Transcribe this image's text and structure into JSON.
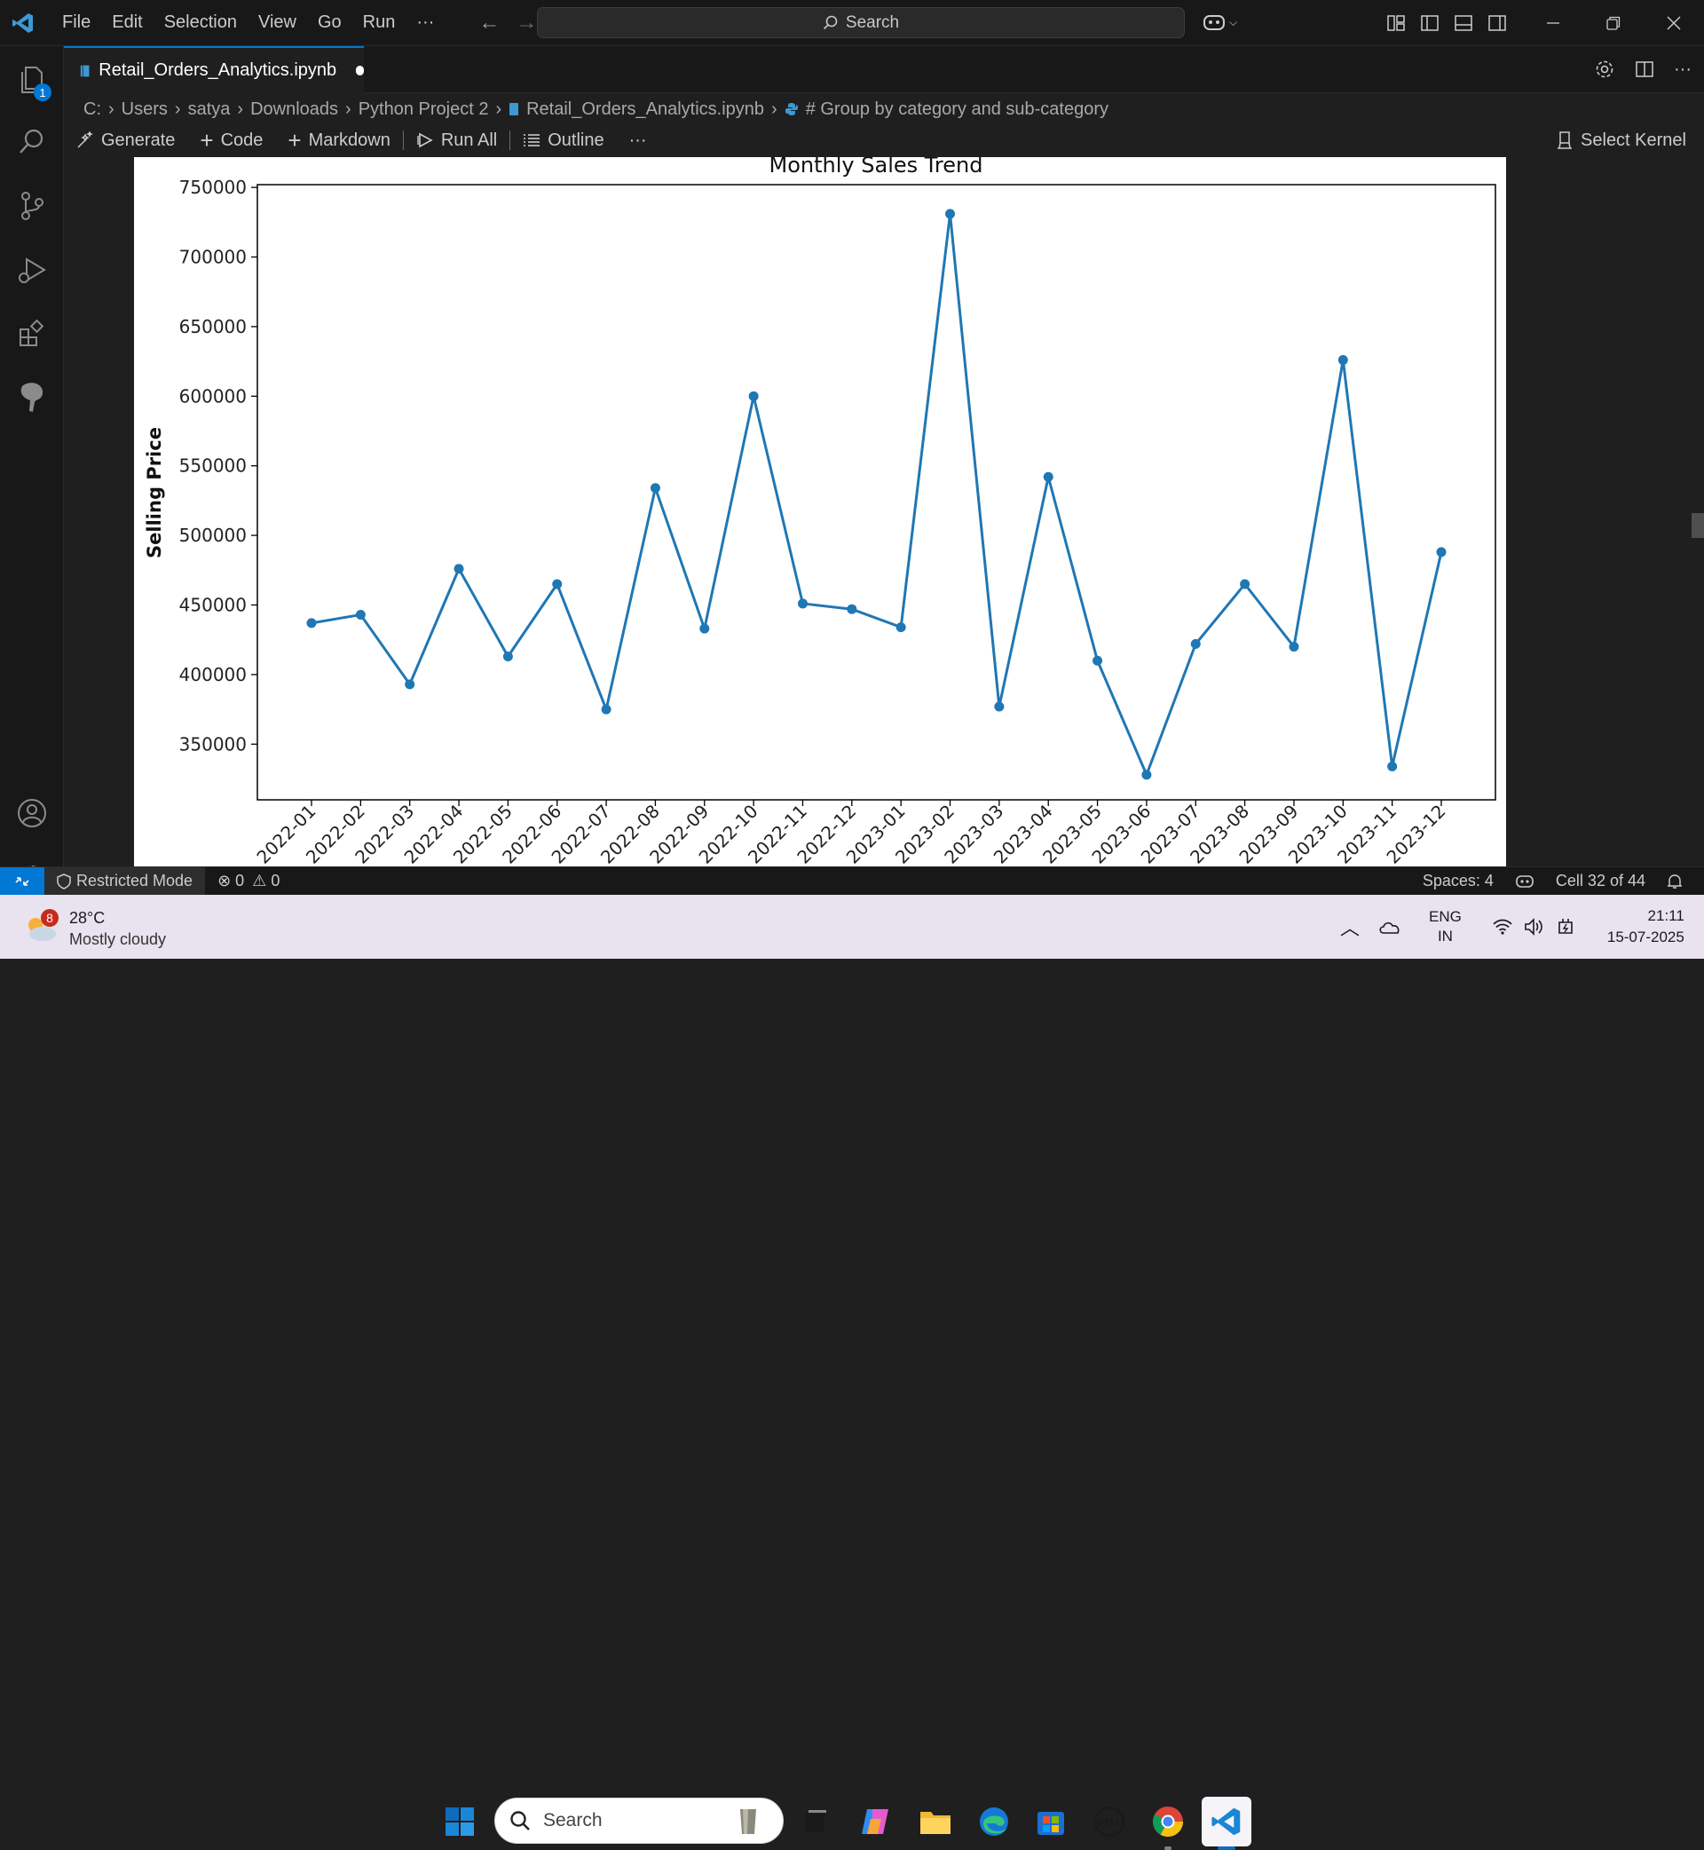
{
  "titlebar": {
    "menu": [
      "File",
      "Edit",
      "Selection",
      "View",
      "Go",
      "Run",
      "···"
    ],
    "search_placeholder": "Search"
  },
  "activity": {
    "explorer_badge": "1"
  },
  "tab": {
    "label": "Retail_Orders_Analytics.ipynb"
  },
  "breadcrumb": [
    "C:",
    "Users",
    "satya",
    "Downloads",
    "Python Project 2",
    "Retail_Orders_Analytics.ipynb",
    "# Group by category and sub-category"
  ],
  "toolbar": {
    "generate": "Generate",
    "code": "Code",
    "markdown": "Markdown",
    "run_all": "Run All",
    "outline": "Outline",
    "more": "···",
    "select_kernel": "Select Kernel"
  },
  "statusbar": {
    "restricted": "Restricted Mode",
    "errors": "0",
    "warnings": "0",
    "spaces": "Spaces: 4",
    "cell": "Cell 32 of 44"
  },
  "taskbar": {
    "weather_badge": "8",
    "temp": "28°C",
    "weather": "Mostly cloudy",
    "search": "Search",
    "lang_top": "ENG",
    "lang_bottom": "IN",
    "time": "21:11",
    "date": "15-07-2025"
  },
  "chart_data": {
    "type": "line",
    "title": "Monthly Sales Trend",
    "xlabel": "",
    "ylabel": "Selling Price",
    "ylim": [
      310000,
      752000
    ],
    "yticks": [
      350000,
      400000,
      450000,
      500000,
      550000,
      600000,
      650000,
      700000,
      750000
    ],
    "color": "#1f77b4",
    "categories": [
      "2022-01",
      "2022-02",
      "2022-03",
      "2022-04",
      "2022-05",
      "2022-06",
      "2022-07",
      "2022-08",
      "2022-09",
      "2022-10",
      "2022-11",
      "2022-12",
      "2023-01",
      "2023-02",
      "2023-03",
      "2023-04",
      "2023-05",
      "2023-06",
      "2023-07",
      "2023-08",
      "2023-09",
      "2023-10",
      "2023-11",
      "2023-12"
    ],
    "values": [
      437000,
      443000,
      393000,
      476000,
      413000,
      465000,
      375000,
      534000,
      433000,
      600000,
      451000,
      447000,
      434000,
      731000,
      377000,
      542000,
      410000,
      328000,
      422000,
      465000,
      420000,
      626000,
      334000,
      488000
    ]
  }
}
